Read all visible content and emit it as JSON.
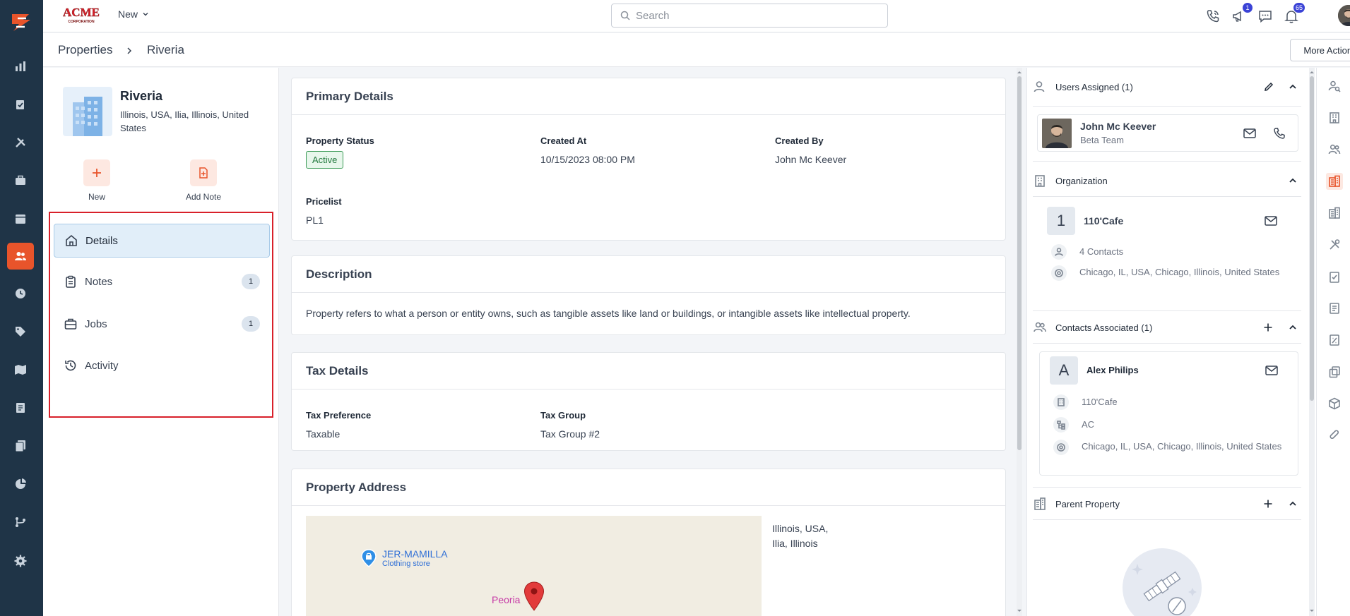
{
  "topbar": {
    "new_label": "New",
    "search_placeholder": "Search",
    "notifications": {
      "megaphone_badge": "1",
      "bell_badge": "65"
    }
  },
  "breadcrumb": {
    "root": "Properties",
    "current": "Riveria"
  },
  "more_actions_label": "More Actions",
  "property": {
    "name": "Riveria",
    "address": "Illinois, USA, Ilia, Illinois, United States",
    "quick_actions": [
      {
        "label": "New"
      },
      {
        "label": "Add Note"
      }
    ]
  },
  "nav": [
    {
      "label": "Details",
      "count": ""
    },
    {
      "label": "Notes",
      "count": "1"
    },
    {
      "label": "Jobs",
      "count": "1"
    },
    {
      "label": "Activity",
      "count": ""
    }
  ],
  "primary_details": {
    "title": "Primary Details",
    "status_label": "Property Status",
    "status_value": "Active",
    "created_at_label": "Created At",
    "created_at_value": "10/15/2023 08:00 PM",
    "created_by_label": "Created By",
    "created_by_value": "John Mc Keever",
    "pricelist_label": "Pricelist",
    "pricelist_value": "PL1"
  },
  "description": {
    "title": "Description",
    "text": "Property refers to what a person or entity owns, such as tangible assets like land or buildings, or intangible assets like intellectual property."
  },
  "tax_details": {
    "title": "Tax Details",
    "preference_label": "Tax Preference",
    "preference_value": "Taxable",
    "group_label": "Tax Group",
    "group_value": "Tax Group #2"
  },
  "property_address": {
    "title": "Property Address",
    "line1": "Illinois, USA,",
    "line2": "Ilia, Illinois",
    "map": {
      "place_name": "JER-MAMILLA",
      "place_type": "Clothing store",
      "city": "Peoria"
    }
  },
  "users_assigned": {
    "title": "Users Assigned (1)",
    "user_name": "John Mc Keever",
    "user_team": "Beta Team"
  },
  "organization": {
    "title": "Organization",
    "initial": "1",
    "name": "110'Cafe",
    "contacts": "4 Contacts",
    "address": "Chicago, IL, USA, Chicago, Illinois, United States"
  },
  "contacts_associated": {
    "title": "Contacts Associated (1)",
    "initial": "A",
    "name": "Alex Philips",
    "org": "110'Cafe",
    "code": "AC",
    "address": "Chicago, IL, USA, Chicago, Illinois, United States"
  },
  "parent_property": {
    "title": "Parent Property"
  },
  "colors": {
    "accent": "#e8542b",
    "sidebar": "#1f3447",
    "highlight": "#d8202a",
    "badge": "#3b43d6"
  }
}
